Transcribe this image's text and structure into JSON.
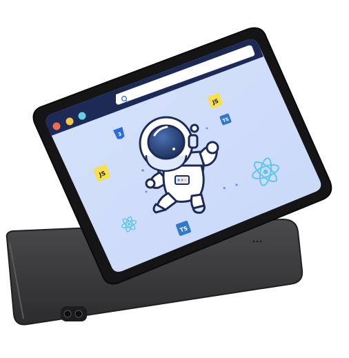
{
  "badges": {
    "js_top": "JS",
    "ts_top": "TS",
    "css_top": "3",
    "js_left": "JS",
    "ts_bottom": "TS"
  },
  "icons": {
    "window_controls": [
      "close-dot",
      "minimize-dot",
      "maximize-dot"
    ],
    "search": "search-icon",
    "react": "react-atom-icon",
    "astronaut": "astronaut-illustration"
  },
  "colors": {
    "screen_bg": "#cfdcfa",
    "toolbar": "#1d2a55",
    "dot_red": "#f26a4f",
    "dot_yellow": "#f5c84b",
    "dot_teal": "#67cfe0",
    "js_yellow": "#f7df4e",
    "ts_blue": "#3178c6",
    "css_blue": "#2d6bd8",
    "react_teal": "#5fc6e6",
    "device_gray": "#3b3b3d"
  }
}
